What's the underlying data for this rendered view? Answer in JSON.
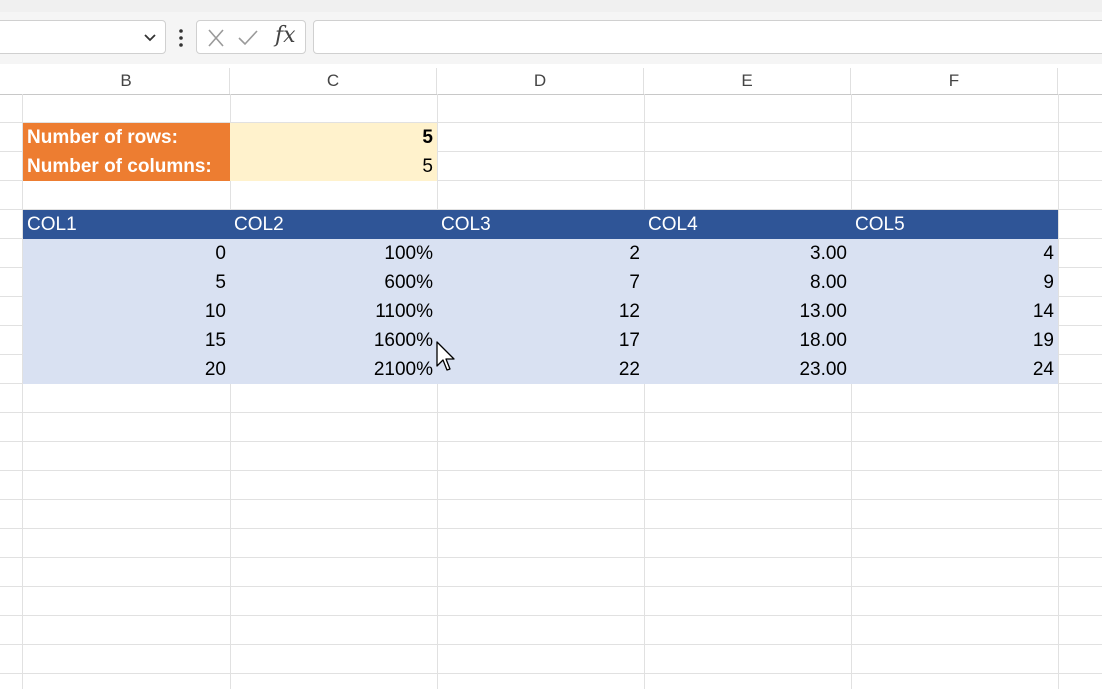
{
  "formula_bar": {
    "name_box_value": "",
    "formula_value": "",
    "fx_label": "fx"
  },
  "column_headers": [
    "B",
    "C",
    "D",
    "E",
    "F"
  ],
  "params": {
    "rows_label": "Number of rows:",
    "rows_value": "5",
    "cols_label": "Number of columns:",
    "cols_value": "5"
  },
  "table": {
    "headers": [
      "COL1",
      "COL2",
      "COL3",
      "COL4",
      "COL5"
    ],
    "rows": [
      [
        "0",
        "100%",
        "2",
        "3.00",
        "4"
      ],
      [
        "5",
        "600%",
        "7",
        "8.00",
        "9"
      ],
      [
        "10",
        "1100%",
        "12",
        "13.00",
        "14"
      ],
      [
        "15",
        "1600%",
        "17",
        "18.00",
        "19"
      ],
      [
        "20",
        "2100%",
        "22",
        "23.00",
        "24"
      ]
    ]
  },
  "colors": {
    "label_fill": "#ed7d31",
    "input_fill": "#fff2cc",
    "header_fill": "#2f5597",
    "row_fill": "#d9e1f2"
  }
}
